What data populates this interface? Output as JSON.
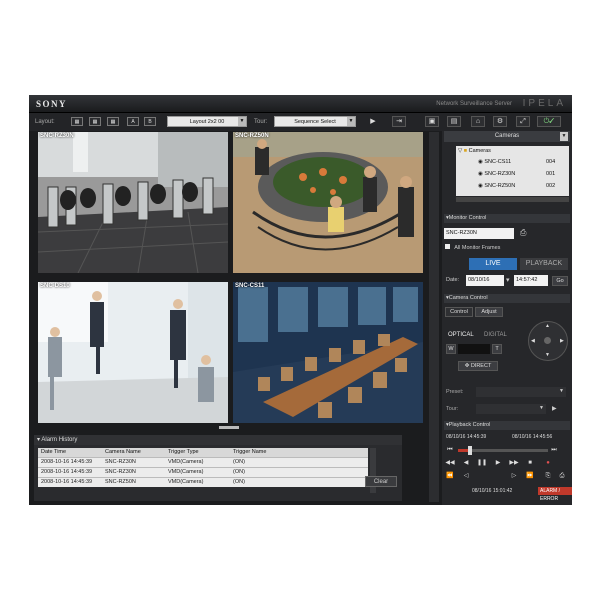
{
  "app": {
    "brand": "SONY",
    "product": "Network Surveillance Server",
    "suite": "IPELA"
  },
  "toolbar": {
    "layout_label": "Layout:",
    "layout_buttons": [
      "A",
      "B"
    ],
    "layout_select": "Layout 2x2 00",
    "tour_label": "Tour:",
    "tour_select": "Sequence Select"
  },
  "cameras": [
    {
      "label": "SNC-RZ30N"
    },
    {
      "label": "SNC-RZ50N"
    },
    {
      "label": "SNC-DS10"
    },
    {
      "label": "SNC-CS11"
    }
  ],
  "alarm_history": {
    "title": "Alarm History",
    "columns": [
      "Date Time",
      "Camera Name",
      "Trigger Type",
      "Trigger Name"
    ],
    "rows": [
      [
        "2008-10-16 14:45:39",
        "SNC-RZ30N",
        "VMD(Camera)",
        "(ON)"
      ],
      [
        "2008-10-16 14:45:39",
        "SNC-RZ30N",
        "VMD(Camera)",
        "(ON)"
      ],
      [
        "2008-10-16 14:45:39",
        "SNC-RZ50N",
        "VMD(Camera)",
        "(ON)"
      ]
    ],
    "clear_label": "Clear"
  },
  "camera_list": {
    "title": "Cameras",
    "root": "Cameras",
    "items": [
      {
        "name": "SNC-CS11",
        "id": "004"
      },
      {
        "name": "SNC-RZ30N",
        "id": "001"
      },
      {
        "name": "SNC-RZ50N",
        "id": "002"
      }
    ]
  },
  "monitor_control": {
    "title": "Monitor Control",
    "camera": "SNC-RZ30N",
    "all_frames_label": "All Monitor Frames",
    "live_label": "LIVE",
    "playback_label": "PLAYBACK",
    "date_label": "Date:",
    "date": "08/10/16",
    "time": "14:57:42",
    "go_label": "Go"
  },
  "camera_control": {
    "title": "Camera Control",
    "tabs": [
      "Control",
      "Adjust"
    ],
    "optical_label": "OPTICAL",
    "digital_label": "DIGITAL",
    "wide_label": "W",
    "tele_label": "T",
    "direct_label": "DIRECT",
    "preset_label": "Preset:",
    "tour_label": "Tour:"
  },
  "playback_control": {
    "title": "Playback Control",
    "start_time": "08/10/16 14:45:39",
    "end_time": "08/10/16 14:45:56",
    "current_time": "08/10/16 15:01:42",
    "status_badge": "ALARM / ERROR"
  },
  "colors": {
    "live_accent": "#2d6fb5",
    "alert": "#c0392b"
  }
}
